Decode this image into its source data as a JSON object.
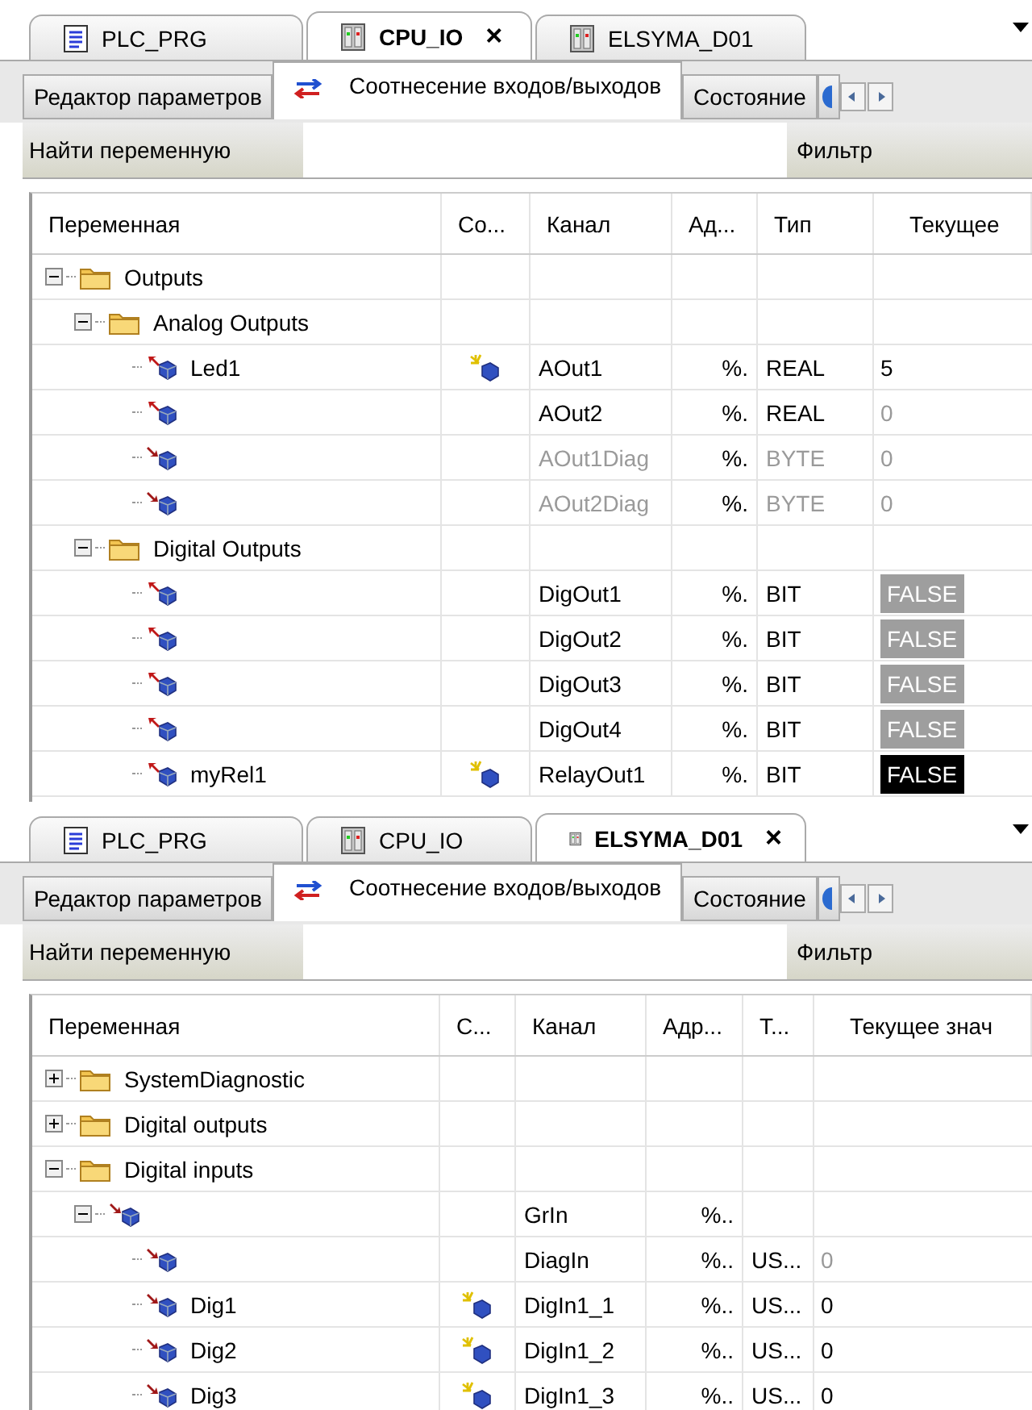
{
  "panels": [
    {
      "doc_tabs": [
        {
          "label": "PLC_PRG",
          "kind": "doc",
          "selected": false
        },
        {
          "label": "CPU_IO",
          "kind": "device",
          "selected": true,
          "close": "×"
        },
        {
          "label": "ELSYMA_D01",
          "kind": "device",
          "selected": false
        }
      ],
      "view_tabs": [
        {
          "label": "Редактор параметров",
          "selected": false
        },
        {
          "label": "Соотнесение входов/выходов",
          "selected": true
        },
        {
          "label": "Состояние",
          "selected": false
        }
      ],
      "search": {
        "label": "Найти переменную",
        "filter": "Фильтр"
      },
      "columns": [
        "Переменная",
        "Со...",
        "Канал",
        "Ад...",
        "Тип",
        "Текущее"
      ],
      "rows": [
        {
          "kind": "folder",
          "name": "Outputs",
          "expanded": true,
          "children": [
            {
              "kind": "folder",
              "name": "Analog Outputs",
              "expanded": true,
              "children": [
                {
                  "kind": "output",
                  "name": "Led1",
                  "mapped": true,
                  "channel": "AOut1",
                  "address": "%.",
                  "type": "REAL",
                  "value": "5",
                  "value_boxed": false,
                  "value_inactive": false,
                  "dim": false
                },
                {
                  "kind": "output",
                  "channel": "AOut2",
                  "address": "%.",
                  "type": "REAL",
                  "value": "0",
                  "value_boxed": false,
                  "value_inactive": true,
                  "dim": false
                },
                {
                  "kind": "input",
                  "channel": "AOut1Diag",
                  "address": "%.",
                  "type": "BYTE",
                  "value": "0",
                  "value_boxed": false,
                  "value_inactive": true,
                  "dim": true
                },
                {
                  "kind": "input",
                  "channel": "AOut2Diag",
                  "address": "%.",
                  "type": "BYTE",
                  "value": "0",
                  "value_boxed": false,
                  "value_inactive": true,
                  "dim": true
                }
              ]
            },
            {
              "kind": "folder",
              "name": "Digital Outputs",
              "expanded": true,
              "children": [
                {
                  "kind": "output",
                  "channel": "DigOut1",
                  "address": "%.",
                  "type": "BIT",
                  "value": "FALSE",
                  "value_boxed": true,
                  "value_inactive": true,
                  "dim": false
                },
                {
                  "kind": "output",
                  "channel": "DigOut2",
                  "address": "%.",
                  "type": "BIT",
                  "value": "FALSE",
                  "value_boxed": true,
                  "value_inactive": true,
                  "dim": false
                },
                {
                  "kind": "output",
                  "channel": "DigOut3",
                  "address": "%.",
                  "type": "BIT",
                  "value": "FALSE",
                  "value_boxed": true,
                  "value_inactive": true,
                  "dim": false
                },
                {
                  "kind": "output",
                  "channel": "DigOut4",
                  "address": "%.",
                  "type": "BIT",
                  "value": "FALSE",
                  "value_boxed": true,
                  "value_inactive": true,
                  "dim": false
                },
                {
                  "kind": "output",
                  "name": "myRel1",
                  "mapped": true,
                  "channel": "RelayOut1",
                  "address": "%.",
                  "type": "BIT",
                  "value": "FALSE",
                  "value_boxed": true,
                  "value_inactive": false,
                  "dim": false
                }
              ]
            }
          ]
        }
      ]
    },
    {
      "doc_tabs": [
        {
          "label": "PLC_PRG",
          "kind": "doc",
          "selected": false
        },
        {
          "label": "CPU_IO",
          "kind": "device",
          "selected": false
        },
        {
          "label": "ELSYMA_D01",
          "kind": "device",
          "selected": true,
          "close": "×"
        }
      ],
      "view_tabs": [
        {
          "label": "Редактор параметров",
          "selected": false
        },
        {
          "label": "Соотнесение входов/выходов",
          "selected": true
        },
        {
          "label": "Состояние",
          "selected": false
        }
      ],
      "search": {
        "label": "Найти переменную",
        "filter": "Фильтр"
      },
      "columns": [
        "Переменная",
        "С...",
        "Канал",
        "Адр...",
        "Т...",
        "Текущее знач"
      ],
      "rows": [
        {
          "kind": "folder",
          "name": "SystemDiagnostic",
          "expanded": false
        },
        {
          "kind": "folder",
          "name": "Digital outputs",
          "expanded": false
        },
        {
          "kind": "folder",
          "name": "Digital inputs",
          "expanded": true,
          "children": [
            {
              "kind": "input",
              "channel": "GrIn",
              "address": "%..",
              "expanded": true,
              "children": [
                {
                  "kind": "input",
                  "channel": "DiagIn",
                  "address": "%..",
                  "type": "US...",
                  "value": "0",
                  "value_boxed": false,
                  "value_inactive": true,
                  "dim": false
                },
                {
                  "kind": "input",
                  "name": "Dig1",
                  "mapped": true,
                  "channel": "DigIn1_1",
                  "address": "%..",
                  "type": "US...",
                  "value": "0",
                  "value_boxed": false,
                  "value_inactive": false,
                  "dim": false
                },
                {
                  "kind": "input",
                  "name": "Dig2",
                  "mapped": true,
                  "channel": "DigIn1_2",
                  "address": "%..",
                  "type": "US...",
                  "value": "0",
                  "value_boxed": false,
                  "value_inactive": false,
                  "dim": false
                },
                {
                  "kind": "input",
                  "name": "Dig3",
                  "mapped": true,
                  "channel": "DigIn1_3",
                  "address": "%..",
                  "type": "US...",
                  "value": "0",
                  "value_boxed": false,
                  "value_inactive": false,
                  "dim": false
                }
              ]
            }
          ]
        }
      ]
    }
  ]
}
